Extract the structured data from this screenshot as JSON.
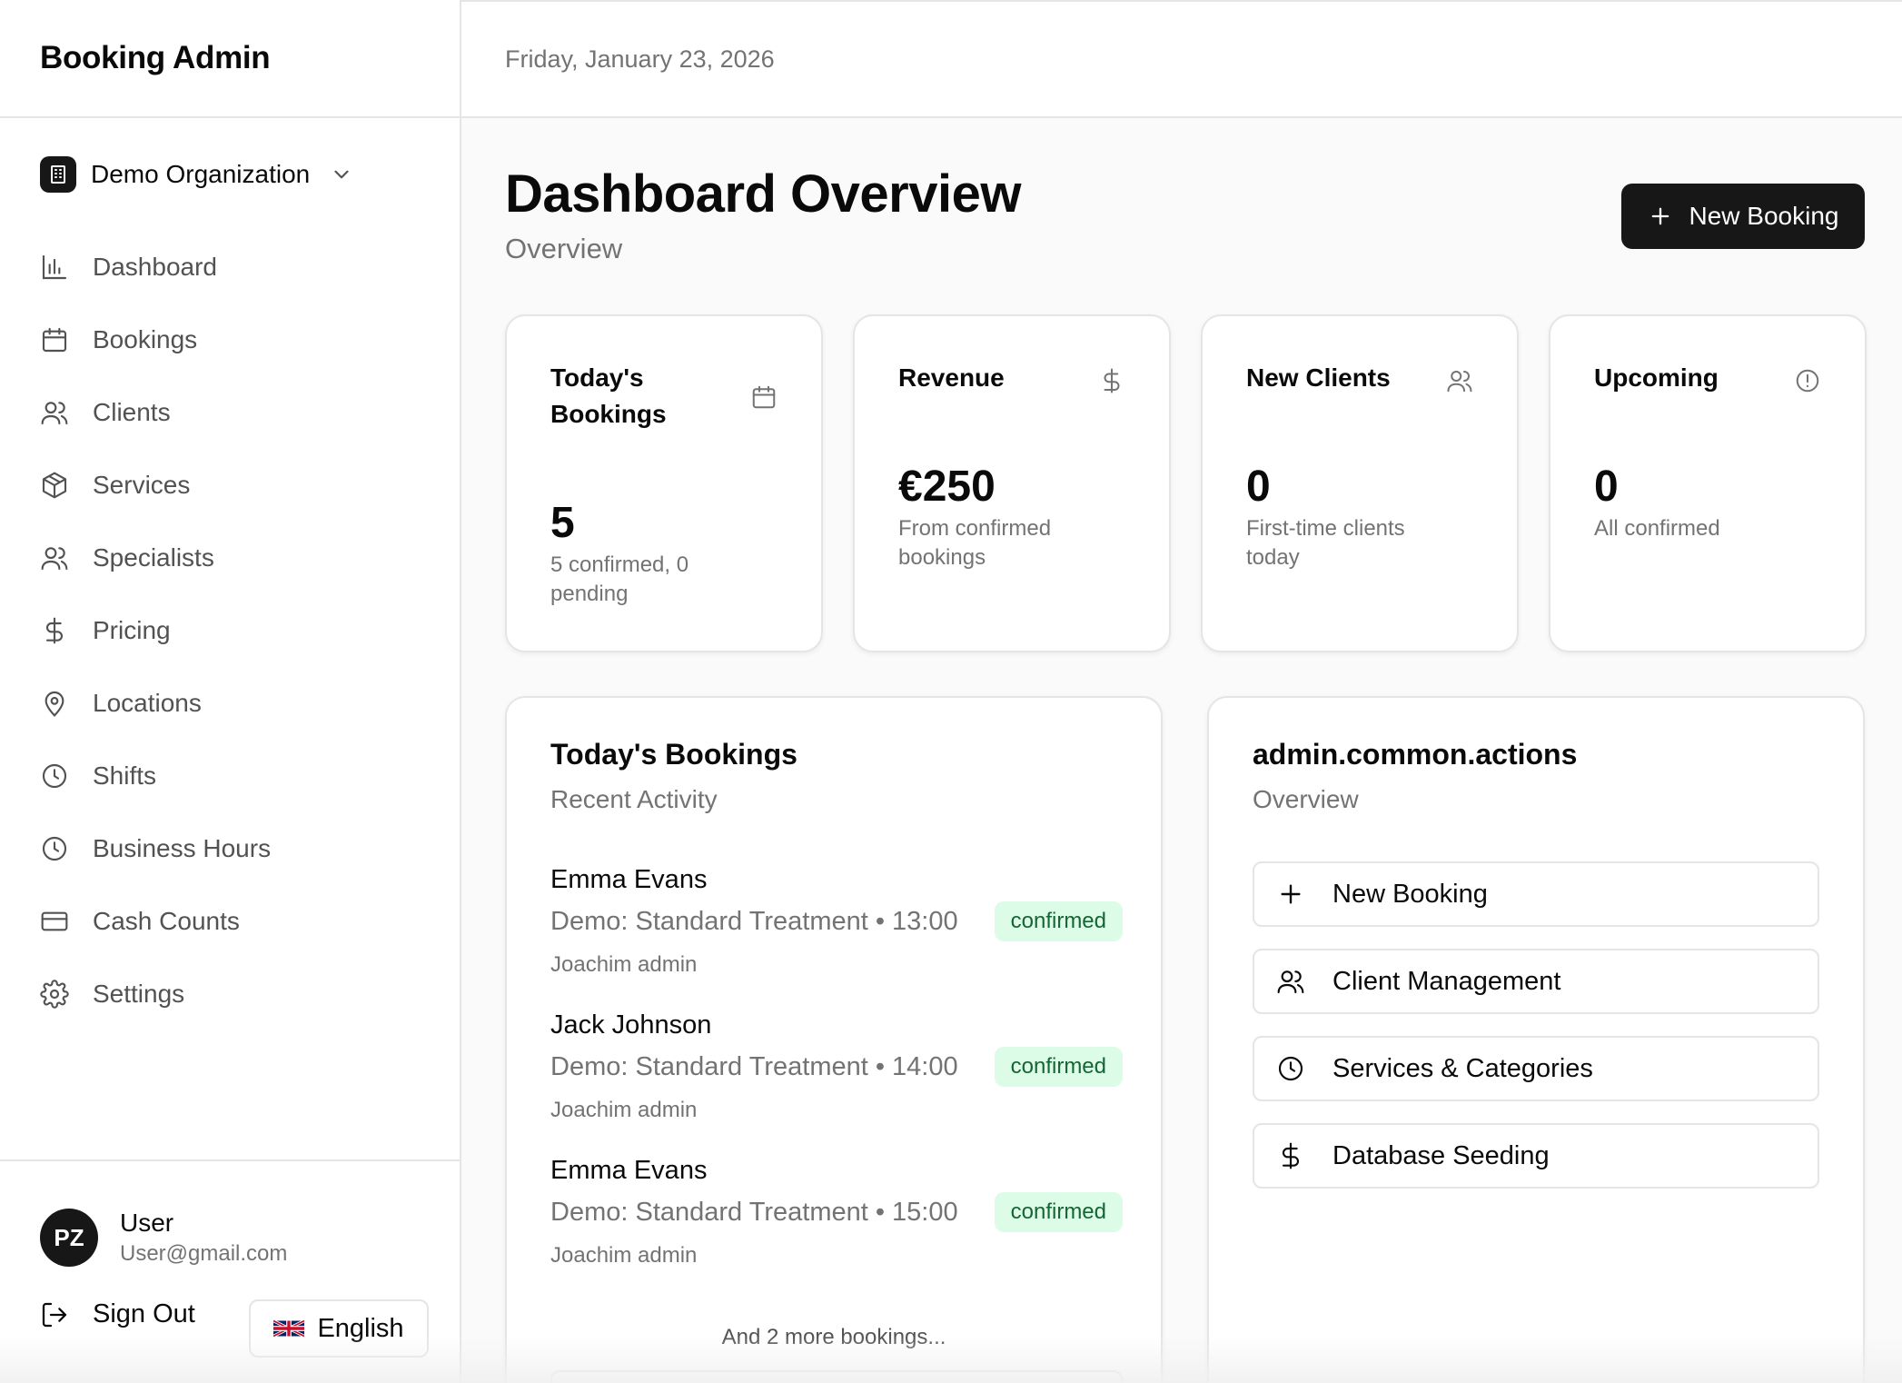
{
  "sidebar": {
    "brand": "Booking Admin",
    "organization": "Demo Organization",
    "items": [
      {
        "label": "Dashboard",
        "icon": "bar-chart-icon"
      },
      {
        "label": "Bookings",
        "icon": "calendar-icon"
      },
      {
        "label": "Clients",
        "icon": "users-icon"
      },
      {
        "label": "Services",
        "icon": "package-icon"
      },
      {
        "label": "Specialists",
        "icon": "users-icon"
      },
      {
        "label": "Pricing",
        "icon": "dollar-icon"
      },
      {
        "label": "Locations",
        "icon": "map-pin-icon"
      },
      {
        "label": "Shifts",
        "icon": "clock-icon"
      },
      {
        "label": "Business Hours",
        "icon": "clock-icon"
      },
      {
        "label": "Cash Counts",
        "icon": "credit-card-icon"
      },
      {
        "label": "Settings",
        "icon": "gear-icon"
      }
    ],
    "user": {
      "initials": "PZ",
      "name": "User",
      "email": "User@gmail.com"
    },
    "sign_out": "Sign Out",
    "language": "English"
  },
  "header": {
    "date": "Friday, January 23, 2026"
  },
  "main": {
    "title": "Dashboard Overview",
    "subtitle": "Overview",
    "new_booking_label": "New Booking",
    "stats": [
      {
        "title": "Today's Bookings",
        "value": "5",
        "desc": "5 confirmed, 0 pending",
        "icon": "calendar-icon"
      },
      {
        "title": "Revenue",
        "value": "€250",
        "desc": "From confirmed bookings",
        "icon": "dollar-icon"
      },
      {
        "title": "New Clients",
        "value": "0",
        "desc": "First-time clients today",
        "icon": "users-icon"
      },
      {
        "title": "Upcoming",
        "value": "0",
        "desc": "All confirmed",
        "icon": "alert-circle-icon"
      }
    ],
    "todays_bookings": {
      "title": "Today's Bookings",
      "subtitle": "Recent Activity",
      "items": [
        {
          "client": "Emma Evans",
          "service": "Demo: Standard Treatment • 13:00",
          "specialist": "Joachim admin",
          "status": "confirmed"
        },
        {
          "client": "Jack Johnson",
          "service": "Demo: Standard Treatment • 14:00",
          "specialist": "Joachim admin",
          "status": "confirmed"
        },
        {
          "client": "Emma Evans",
          "service": "Demo: Standard Treatment • 15:00",
          "specialist": "Joachim admin",
          "status": "confirmed"
        }
      ],
      "more": "And 2 more bookings..."
    },
    "actions": {
      "title": "admin.common.actions",
      "subtitle": "Overview",
      "items": [
        {
          "label": "New Booking",
          "icon": "plus-icon"
        },
        {
          "label": "Client Management",
          "icon": "users-icon"
        },
        {
          "label": "Services & Categories",
          "icon": "clock-icon"
        },
        {
          "label": "Database Seeding",
          "icon": "dollar-icon"
        }
      ]
    }
  },
  "colors": {
    "primary": "#171717",
    "badge_bg": "#dcfce7",
    "badge_text": "#166534",
    "muted": "#737373",
    "border": "#e5e5e5"
  }
}
